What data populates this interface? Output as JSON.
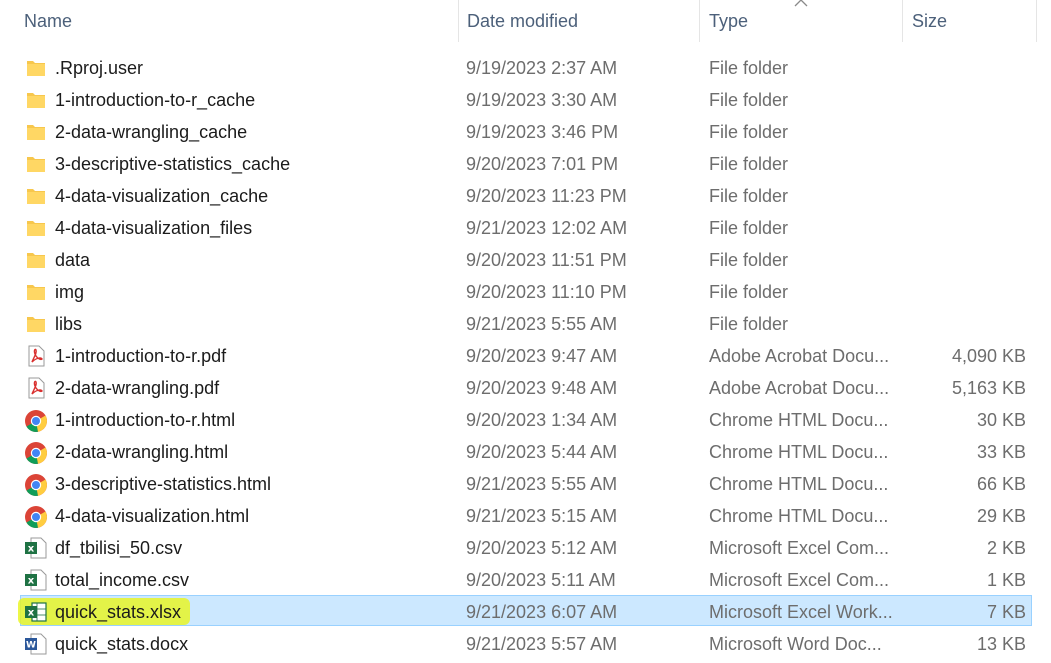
{
  "columns": {
    "name": "Name",
    "date": "Date modified",
    "type": "Type",
    "size": "Size"
  },
  "sort_indicator": "chevron-up-icon",
  "colors": {
    "selection": "#cce8ff",
    "selection_border": "#99d1ff",
    "folder": "#f7c74d",
    "pdf": "#d9302f",
    "excel": "#1f7244",
    "word": "#2b579a",
    "highlight": "#e9f51a"
  },
  "files": [
    {
      "name": ".Rproj.user",
      "date": "9/19/2023 2:37 AM",
      "type": "File folder",
      "size": "",
      "icon": "folder-icon"
    },
    {
      "name": "1-introduction-to-r_cache",
      "date": "9/19/2023 3:30 AM",
      "type": "File folder",
      "size": "",
      "icon": "folder-icon"
    },
    {
      "name": "2-data-wrangling_cache",
      "date": "9/19/2023 3:46 PM",
      "type": "File folder",
      "size": "",
      "icon": "folder-icon"
    },
    {
      "name": "3-descriptive-statistics_cache",
      "date": "9/20/2023 7:01 PM",
      "type": "File folder",
      "size": "",
      "icon": "folder-icon"
    },
    {
      "name": "4-data-visualization_cache",
      "date": "9/20/2023 11:23 PM",
      "type": "File folder",
      "size": "",
      "icon": "folder-icon"
    },
    {
      "name": "4-data-visualization_files",
      "date": "9/21/2023 12:02 AM",
      "type": "File folder",
      "size": "",
      "icon": "folder-icon"
    },
    {
      "name": "data",
      "date": "9/20/2023 11:51 PM",
      "type": "File folder",
      "size": "",
      "icon": "folder-icon"
    },
    {
      "name": "img",
      "date": "9/20/2023 11:10 PM",
      "type": "File folder",
      "size": "",
      "icon": "folder-icon"
    },
    {
      "name": "libs",
      "date": "9/21/2023 5:55 AM",
      "type": "File folder",
      "size": "",
      "icon": "folder-icon"
    },
    {
      "name": "1-introduction-to-r.pdf",
      "date": "9/20/2023 9:47 AM",
      "type": "Adobe Acrobat Docu...",
      "size": "4,090 KB",
      "icon": "pdf-icon"
    },
    {
      "name": "2-data-wrangling.pdf",
      "date": "9/20/2023 9:48 AM",
      "type": "Adobe Acrobat Docu...",
      "size": "5,163 KB",
      "icon": "pdf-icon"
    },
    {
      "name": "1-introduction-to-r.html",
      "date": "9/20/2023 1:34 AM",
      "type": "Chrome HTML Docu...",
      "size": "30 KB",
      "icon": "chrome-icon"
    },
    {
      "name": "2-data-wrangling.html",
      "date": "9/20/2023 5:44 AM",
      "type": "Chrome HTML Docu...",
      "size": "33 KB",
      "icon": "chrome-icon"
    },
    {
      "name": "3-descriptive-statistics.html",
      "date": "9/21/2023 5:55 AM",
      "type": "Chrome HTML Docu...",
      "size": "66 KB",
      "icon": "chrome-icon"
    },
    {
      "name": "4-data-visualization.html",
      "date": "9/21/2023 5:15 AM",
      "type": "Chrome HTML Docu...",
      "size": "29 KB",
      "icon": "chrome-icon"
    },
    {
      "name": "df_tbilisi_50.csv",
      "date": "9/20/2023 5:12 AM",
      "type": "Microsoft Excel Com...",
      "size": "2 KB",
      "icon": "excel-csv-icon"
    },
    {
      "name": "total_income.csv",
      "date": "9/20/2023 5:11 AM",
      "type": "Microsoft Excel Com...",
      "size": "1 KB",
      "icon": "excel-csv-icon"
    },
    {
      "name": "quick_stats.xlsx",
      "date": "9/21/2023 6:07 AM",
      "type": "Microsoft Excel Work...",
      "size": "7 KB",
      "icon": "excel-icon",
      "selected": true,
      "highlighted": true
    },
    {
      "name": "quick_stats.docx",
      "date": "9/21/2023 5:57 AM",
      "type": "Microsoft Word Doc...",
      "size": "13 KB",
      "icon": "word-icon"
    }
  ]
}
